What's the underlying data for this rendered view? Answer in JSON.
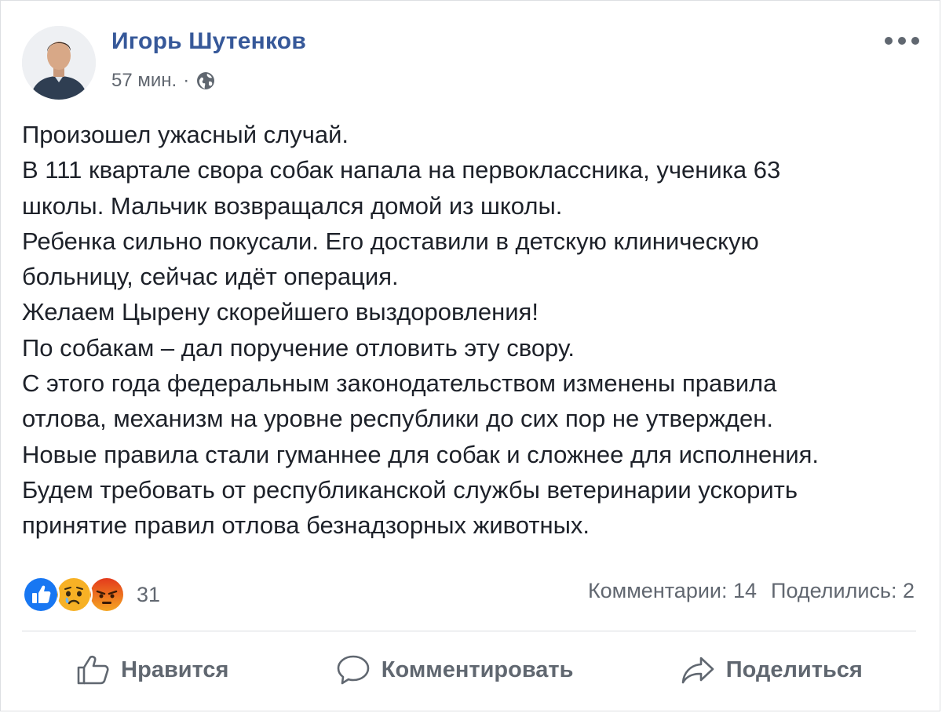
{
  "post": {
    "author": "Игорь Шутенков",
    "time": "57 мин.",
    "separator": "·",
    "privacy_icon": "globe-icon",
    "more_icon": "more-options-icon",
    "lines": [
      "Произошел ужасный случай.",
      "В 111 квартале свора собак напала на первоклассника, ученика 63",
      "школы. Мальчик возвращался домой из школы.",
      "Ребенка сильно покусали. Его доставили в детскую клиническую",
      "больницу, сейчас идёт операция.",
      "Желаем Цырену скорейшего выздоровления!",
      "По собакам – дал поручение отловить эту свору.",
      "С этого года федеральным законодательством изменены правила",
      "отлова, механизм на уровне республики до сих пор не утвержден.",
      "Новые правила стали гуманнее для собак и сложнее для исполнения.",
      "Будем требовать от республиканской службы ветеринарии ускорить",
      "принятие правил отлова безнадзорных животных."
    ]
  },
  "reactions": {
    "icons": [
      "like-icon",
      "sad-icon",
      "angry-icon"
    ],
    "count": "31"
  },
  "stats": {
    "comments": "Комментарии: 14",
    "shares": "Поделились: 2"
  },
  "actions": {
    "like": "Нравится",
    "comment": "Комментировать",
    "share": "Поделиться"
  },
  "colors": {
    "author": "#365899",
    "text": "#1d2129",
    "muted": "#616770",
    "like": "#1877f2",
    "sad": "#f7b125",
    "angry": "#e9710f"
  }
}
